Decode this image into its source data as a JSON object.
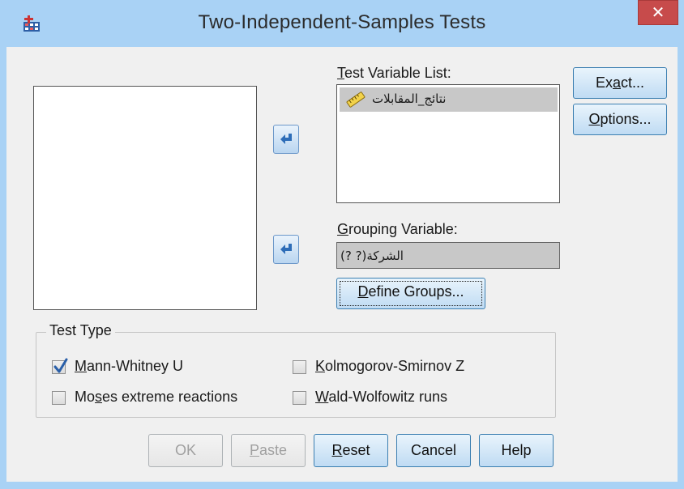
{
  "window": {
    "title": "Two-Independent-Samples Tests",
    "close_glyph": "✕"
  },
  "test_variable": {
    "label_hotkey": "T",
    "label_rest": "est Variable List:",
    "items": [
      {
        "text": "نتائج_المقابلات",
        "icon": "ruler-scale-icon"
      }
    ]
  },
  "grouping": {
    "label_hotkey": "G",
    "label_rest": "rouping Variable:",
    "value": "الشركة(? ?)",
    "define_hotkey": "D",
    "define_rest": "efine Groups..."
  },
  "side_buttons": {
    "exact_pre": "Ex",
    "exact_hotkey": "a",
    "exact_post": "ct...",
    "options_hotkey": "O",
    "options_rest": "ptions..."
  },
  "test_type": {
    "legend": "Test Type",
    "options": [
      {
        "hotkey": "M",
        "rest": "ann-Whitney U",
        "checked": true
      },
      {
        "hotkey": "K",
        "rest": "olmogorov-Smirnov Z",
        "checked": false
      },
      {
        "pre": "Mo",
        "hotkey": "s",
        "rest": "es extreme reactions",
        "checked": false
      },
      {
        "hotkey": "W",
        "rest": "ald-Wolfowitz runs",
        "checked": false
      }
    ]
  },
  "footer": {
    "ok": "OK",
    "paste_hotkey": "P",
    "paste_rest": "aste",
    "reset_hotkey": "R",
    "reset_rest": "eset",
    "cancel": "Cancel",
    "help": "Help"
  },
  "colors": {
    "frame": "#a9d2f5",
    "close": "#c74b4b",
    "selection": "#c8c8c8",
    "check": "#2a5fa8"
  }
}
